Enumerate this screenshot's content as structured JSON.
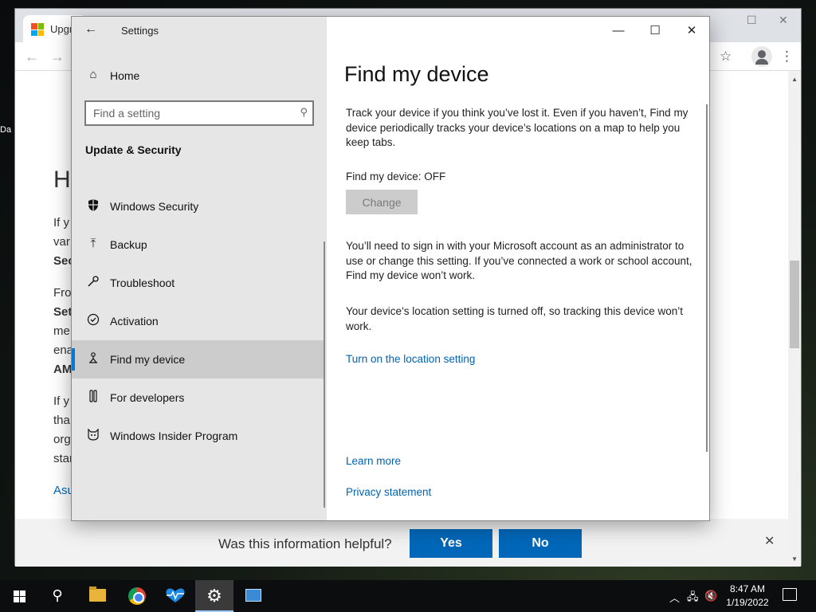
{
  "browser": {
    "tab_title": "Upgr",
    "bg_heading": "H",
    "bg_lines": [
      "If y",
      "var",
      "Sec",
      "Fro",
      "Set",
      "me",
      "ena",
      "AM",
      "If y",
      "tha",
      "org",
      "star",
      "Asu"
    ],
    "helpful": {
      "question": "Was this information helpful?",
      "yes_label": "Yes",
      "no_label": "No"
    }
  },
  "desktop": {
    "icon_label": "Da"
  },
  "settings": {
    "app_title": "Settings",
    "home_label": "Home",
    "search_placeholder": "Find a setting",
    "section_heading": "Update & Security",
    "nav_items": [
      {
        "label": "Windows Security",
        "icon": "shield-icon"
      },
      {
        "label": "Backup",
        "icon": "backup-icon"
      },
      {
        "label": "Troubleshoot",
        "icon": "wrench-icon"
      },
      {
        "label": "Activation",
        "icon": "check-circle-icon"
      },
      {
        "label": "Find my device",
        "icon": "find-device-icon",
        "selected": true
      },
      {
        "label": "For developers",
        "icon": "developer-tools-icon"
      },
      {
        "label": "Windows Insider Program",
        "icon": "insider-cat-icon"
      }
    ],
    "page": {
      "title": "Find my device",
      "intro": "Track your device if you think you’ve lost it. Even if you haven’t, Find my device periodically tracks your device’s locations on a map to help you keep tabs.",
      "status": "Find my device: OFF",
      "change_label": "Change",
      "admin_note": "You’ll need to sign in with your Microsoft account as an administrator to use or change this setting. If you’ve connected a work or school account, Find my device won’t work.",
      "location_note": "Your device’s location setting is turned off, so tracking this device won’t work.",
      "location_link": "Turn on the location setting",
      "learn_more": "Learn more",
      "privacy": "Privacy statement"
    }
  },
  "taskbar": {
    "time": "8:47 AM",
    "date": "1/19/2022"
  },
  "colors": {
    "accent": "#0078d4",
    "link": "#0063b1",
    "button_blue": "#0067b8"
  }
}
